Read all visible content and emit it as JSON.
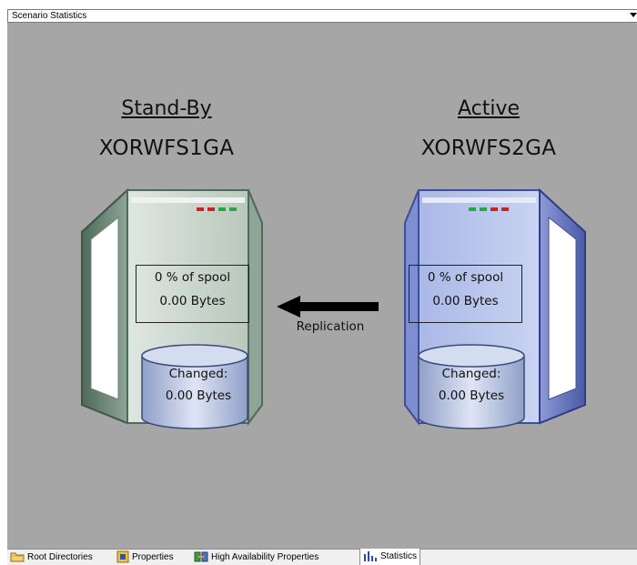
{
  "panel": {
    "title": "Scenario Statistics"
  },
  "standby": {
    "role": "Stand-By",
    "host": "XORWFS1GA",
    "spool_percent": "0 % of spool",
    "spool_bytes": "0.00 Bytes",
    "changed_label": "Changed:",
    "changed_bytes": "0.00 Bytes",
    "led_colors": [
      "#cc2222",
      "#cc2222",
      "#22aa44",
      "#22aa44"
    ]
  },
  "active": {
    "role": "Active",
    "host": "XORWFS2GA",
    "spool_percent": "0 % of spool",
    "spool_bytes": "0.00 Bytes",
    "changed_label": "Changed:",
    "changed_bytes": "0.00 Bytes",
    "led_colors": [
      "#22aa44",
      "#22aa44",
      "#cc2222",
      "#cc2222"
    ]
  },
  "replication": {
    "label": "Replication",
    "direction": "active-to-standby"
  },
  "tabs": [
    {
      "label": "Root Directories",
      "icon": "folder-icon",
      "active": false
    },
    {
      "label": "Properties",
      "icon": "properties-icon",
      "active": false
    },
    {
      "label": "High Availability Properties",
      "icon": "ha-properties-icon",
      "active": false
    },
    {
      "label": "Statistics",
      "icon": "statistics-icon",
      "active": true
    }
  ],
  "colors": {
    "stage_background": "#a6a6a6",
    "standby_server": "#c9d6cc",
    "active_server": "#b8c4e8"
  }
}
